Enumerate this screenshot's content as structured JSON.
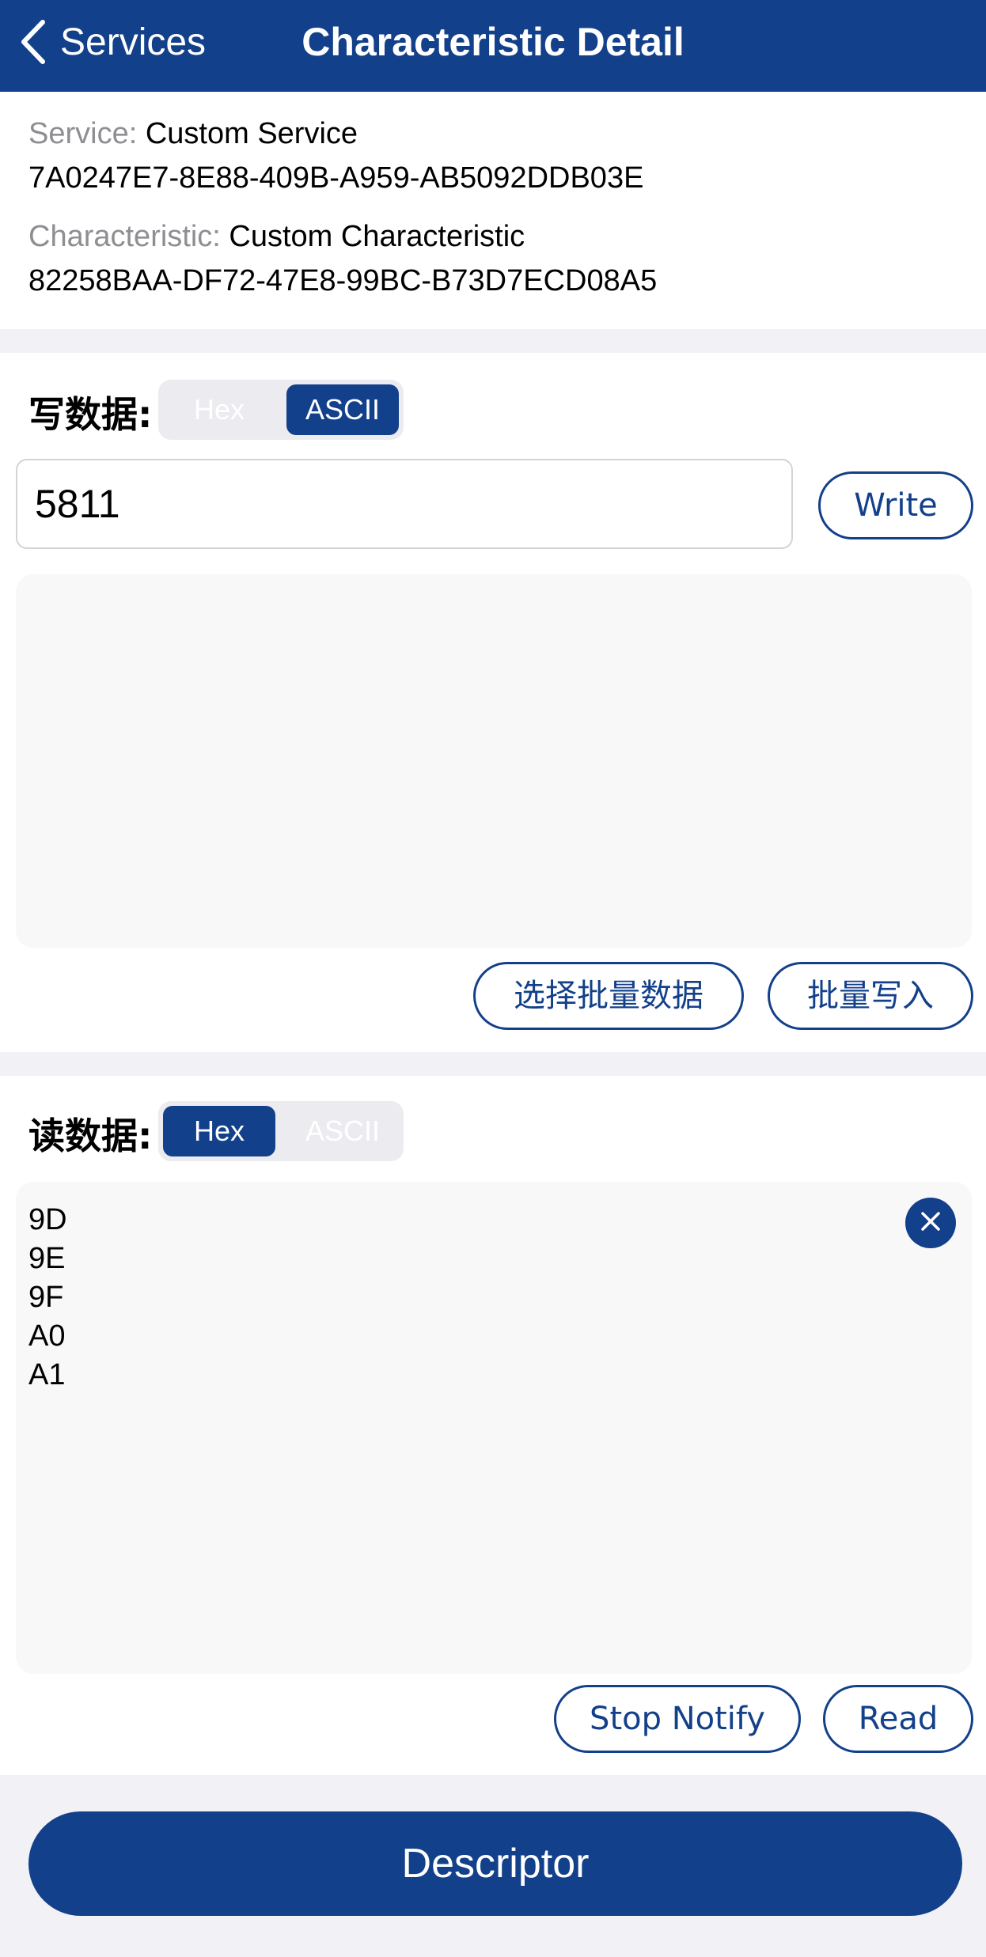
{
  "navbar": {
    "back_label": "Services",
    "title": "Characteristic Detail"
  },
  "info": {
    "service_key": "Service:",
    "service_name": "Custom Service",
    "service_uuid": "7A0247E7-8E88-409B-A959-AB5092DDB03E",
    "characteristic_key": "Characteristic:",
    "characteristic_name": "Custom Characteristic",
    "characteristic_uuid": "82258BAA-DF72-47E8-99BC-B73D7ECD08A5"
  },
  "write": {
    "label": "写数据:",
    "format_options": [
      "Hex",
      "ASCII"
    ],
    "selected_format": "ASCII",
    "input_value": "5811",
    "write_button": "Write",
    "batch_area_text": "",
    "select_batch_button": "选择批量数据",
    "batch_write_button": "批量写入"
  },
  "read": {
    "label": "读数据:",
    "format_options": [
      "Hex",
      "ASCII"
    ],
    "selected_format": "Hex",
    "lines": [
      "9D",
      "9E",
      "9F",
      "A0",
      "A1"
    ],
    "stop_notify_button": "Stop Notify",
    "read_button": "Read"
  },
  "descriptor_button": "Descriptor",
  "colors": {
    "primary": "#13408a",
    "background": "#f1f1f6",
    "muted_text": "#8e8e93"
  },
  "icons": {
    "back": "chevron-left-icon",
    "clear": "close-icon"
  }
}
